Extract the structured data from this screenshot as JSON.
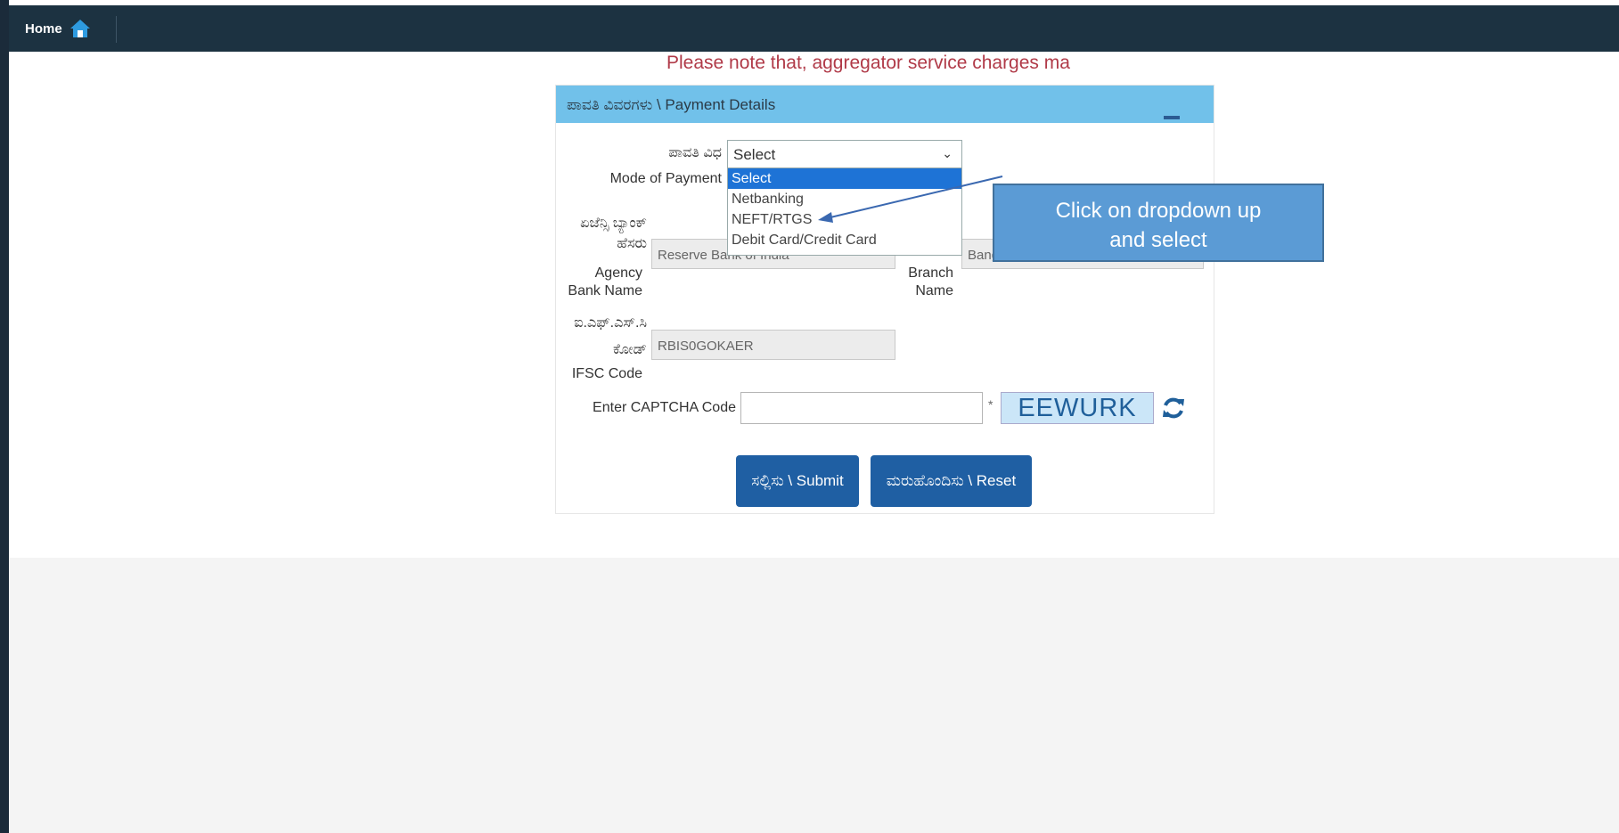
{
  "topbar": {
    "home_label": "Home"
  },
  "notice": "Please note that, aggregator service charges ma",
  "panel": {
    "title": "ಪಾವತಿ ವಿವರಗಳು \\ Payment Details"
  },
  "form": {
    "mode_label_kn": "ಪಾವತಿ ವಿಧ",
    "mode_label_en": "Mode of Payment",
    "mode_selected": "Select",
    "mode_options": [
      "Select",
      "Netbanking",
      "NEFT/RTGS",
      "Debit Card/Credit Card"
    ],
    "agency_label_kn1": "ಏಜೆನ್ಸಿ ಬ್ಯಾಂಕ್",
    "agency_label_kn2": "ಹೆಸರು",
    "agency_label_en1": "Agency",
    "agency_label_en2": "Bank Name",
    "agency_value": "Reserve Bank of India",
    "branch_label_en1": "Branch",
    "branch_label_en2": "Name",
    "branch_value": "Bang",
    "ifsc_label_kn1": "ಐ.ಎಫ್.ಎಸ್.ಸಿ",
    "ifsc_label_kn2": "ಕೋಡ್",
    "ifsc_label_en": "IFSC Code",
    "ifsc_value": "RBIS0GOKAER",
    "captcha_label": "Enter CAPTCHA Code",
    "captcha_value": "",
    "captcha_required": "*",
    "captcha_text": "EEWURK"
  },
  "buttons": {
    "submit": "ಸಲ್ಲಿಸು \\ Submit",
    "reset": "ಮರುಹೊಂದಿಸು \\ Reset"
  },
  "callout": {
    "line1": "Click on dropdown up",
    "line2": "and select"
  },
  "colors": {
    "topbar": "#1c3241",
    "panel_header": "#71c1ea",
    "button": "#1f5fa3",
    "notice": "#b03a48",
    "highlight": "#1e73d6"
  }
}
